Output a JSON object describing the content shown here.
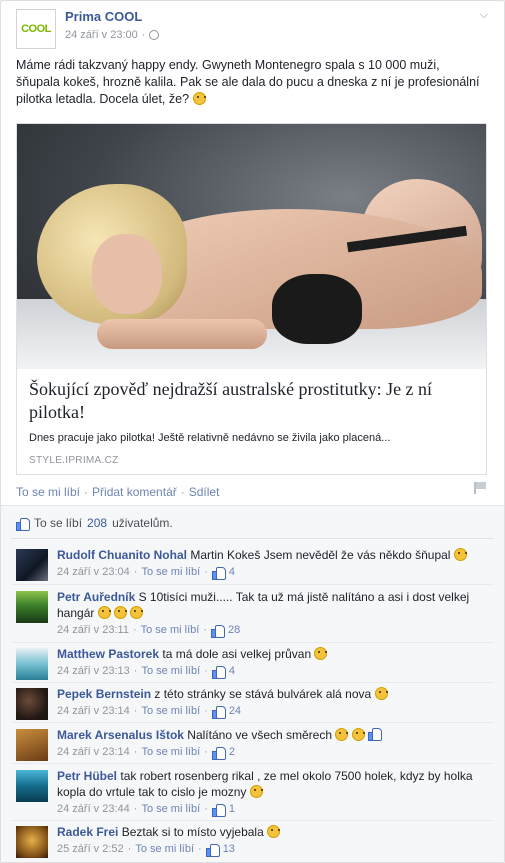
{
  "post": {
    "page_name": "Prima COOL",
    "logo_text": "COOL",
    "timestamp": "24 září v 23:00",
    "dot": "·",
    "text": "Máme rádi takzvaný happy endy. Gwyneth Montenegro spala s 10 000 muži, šňupala kokeš, hrozně kalila. Pak se ale dala do pucu a dneska z ní je profesionální pilotka letadla. Docela úlet, že?"
  },
  "preview": {
    "title": "Šokující zpověď nejdražší australské prostitutky: Je z ní pilotka!",
    "description": "Dnes pracuje jako pilotka! Ještě relativně nedávno se živila jako placená...",
    "source": "STYLE.IPRIMA.CZ"
  },
  "actions": {
    "like": "To se mi líbí",
    "comment": "Přidat komentář",
    "share": "Sdílet",
    "separator": "·"
  },
  "likes": {
    "prefix": "To se líbí",
    "count": "208",
    "suffix": "uživatelům."
  },
  "comments": [
    {
      "name": "Rudolf Chuanito Nohal",
      "text": "Martin Kokeš Jsem nevěděl že vás někdo šňupal",
      "time": "24 září v 23:04",
      "like_label": "To se mi líbí",
      "likes": "4"
    },
    {
      "name": "Petr Auředník",
      "text": "S 10tisíci muži..... Tak ta už má jistě nalítáno a asi i dost velkej hangár",
      "time": "24 září v 23:11",
      "like_label": "To se mi líbí",
      "likes": "28"
    },
    {
      "name": "Matthew Pastorek",
      "text": "ta má dole asi velkej průvan",
      "time": "24 září v 23:13",
      "like_label": "To se mi líbí",
      "likes": "4"
    },
    {
      "name": "Pepek Bernstein",
      "text": "z této stránky se stává bulvárek alá nova",
      "time": "24 září v 23:14",
      "like_label": "To se mi líbí",
      "likes": "24"
    },
    {
      "name": "Marek Arsenalus Ištok",
      "text": "Nalítáno ve všech směrech",
      "time": "24 září v 23:14",
      "like_label": "To se mi líbí",
      "likes": "2"
    },
    {
      "name": "Petr Hübel",
      "text": "tak robert rosenberg rikal , ze mel okolo 7500 holek, kdyz by holka kopla do vrtule tak to cislo je mozny",
      "time": "24 září v 23:44",
      "like_label": "To se mi líbí",
      "likes": "1"
    },
    {
      "name": "Radek Frei",
      "text": "Beztak si to místo vyjebala",
      "time": "25 září v 2:52",
      "like_label": "To se mi líbí",
      "likes": "13"
    }
  ],
  "icons": [
    "globe-icon",
    "chevron-down-icon",
    "smiley-icon",
    "thumbs-up-icon",
    "flag-icon"
  ],
  "colors": {
    "link": "#3b5998",
    "muted": "#90949c",
    "background": "#f6f7f9"
  }
}
